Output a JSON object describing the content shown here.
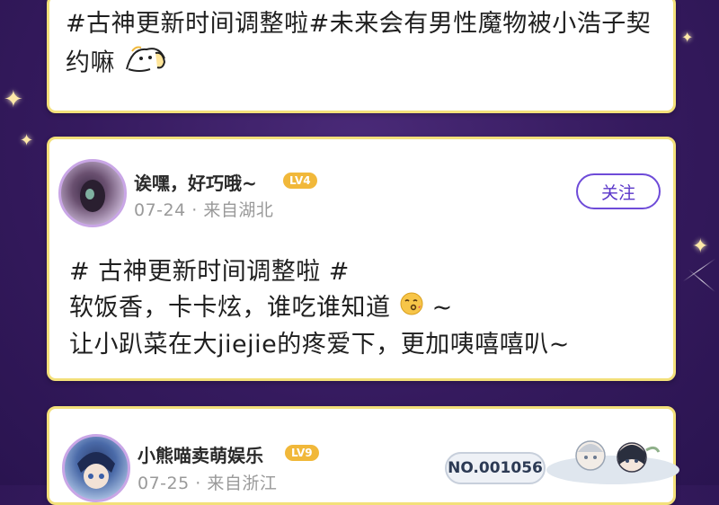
{
  "posts": [
    {
      "lines": [
        "#古神更新时间调整啦#未来会有男性魔物被小浩子契",
        "约嘛"
      ],
      "sticker_icon": "doodle-sticker-icon"
    },
    {
      "username": "诶嘿，好巧哦~",
      "level": "LV4",
      "date": "07-24",
      "location": "· 来自湖北",
      "follow_label": "关注",
      "lines": [
        "# 古神更新时间调整啦 #",
        "软饭香，卡卡炫，谁吃谁知道",
        "让小趴菜在大jiejie的疼爱下，更加咦嘻嘻叭~"
      ],
      "line2_suffix": " ~",
      "emoji_icon": "kissing-face-icon"
    },
    {
      "username": "小熊喵卖萌娱乐",
      "level": "LV9",
      "date": "07-25",
      "location": "· 来自浙江",
      "badge": "NO.001056",
      "decoration_icon": "chibi-characters-icon"
    }
  ],
  "colors": {
    "background": "#351a5e",
    "card_border": "#f3e07a",
    "follow_accent": "#5a36c9",
    "level_badge": "#f1b83a",
    "meta_text": "#9a9a9a"
  }
}
